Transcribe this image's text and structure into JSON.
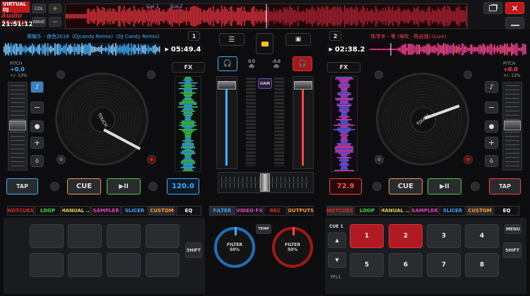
{
  "app": {
    "logo_line1": "VIRTUAL DJ",
    "logo_line2": "Audio TOUCH",
    "clock": "21:51:12",
    "col_label": "COL",
    "wave_label": "WAVE",
    "plus": "+",
    "minus": "−"
  },
  "overview": {
    "cue1": "Cue 1",
    "cue2": "Cue 2"
  },
  "window": {
    "restore_icon": "restore-icon",
    "close_icon": "close-icon",
    "minimize_icon": "minimize-icon"
  },
  "deck1": {
    "number": "1",
    "title": "荣耀乐 - 夜色2018（DJcandy Remix）(DJ Candy Remix)",
    "time": "05:49.4",
    "pitch_label": "PITCH",
    "pitch_value": "+0.0",
    "pitch_range": "+/- 13%",
    "fx": "FX",
    "tap": "TAP",
    "cue": "CUE",
    "play": "▶II",
    "bpm": "120.0",
    "platter_label": "TOUCH",
    "pitch_slider": 0.5
  },
  "deck2": {
    "number": "2",
    "title": "陈学冬 - 等 (电吹 · 陈自强) (Live)",
    "time": "02:38.2",
    "pitch_label": "PITCH",
    "pitch_value": "+0.0",
    "pitch_range": "+/- 13%",
    "fx": "FX",
    "tap": "TAP",
    "cue": "CUE",
    "play": "▶II",
    "bpm": "72.9",
    "platter_label": "TOUCH",
    "pitch_slider": 0.5
  },
  "mixer": {
    "left_db": "0.0",
    "left_db_unit": "db",
    "right_db": "-0.0",
    "right_db_unit": "db",
    "gain": "GAIN",
    "left_volume": 0.95,
    "right_volume": 0.95,
    "crossfader": 0.5
  },
  "tabs_left": [
    {
      "label": "HOTCUES",
      "color": "#e02a2a"
    },
    {
      "label": "LOOP",
      "color": "#3fd13f"
    },
    {
      "label": "MANUAL ...",
      "color": "#e0d040"
    },
    {
      "label": "SAMPLER",
      "color": "#e040c0"
    },
    {
      "label": "SLICER",
      "color": "#40a0ff"
    },
    {
      "label": "CUSTOM",
      "color": "#ff9a30"
    },
    {
      "label": "EQ",
      "color": "#ffffff"
    }
  ],
  "tabs_center": [
    {
      "label": "FILTER",
      "color": "#40a0ff"
    },
    {
      "label": "VIDEO FX",
      "color": "#e040c0"
    },
    {
      "label": "REC",
      "color": "#e02a2a"
    },
    {
      "label": "OUTPUTS",
      "color": "#ff9a30"
    }
  ],
  "tabs_right": [
    {
      "label": "HOTCUES",
      "color": "#e02a2a"
    },
    {
      "label": "LOOP",
      "color": "#3fd13f"
    },
    {
      "label": "MANUAL ...",
      "color": "#e0d040"
    },
    {
      "label": "SAMPLER",
      "color": "#e040c0"
    },
    {
      "label": "SLICER",
      "color": "#40a0ff"
    },
    {
      "label": "CUSTOM",
      "color": "#ff9a30"
    },
    {
      "label": "EQ",
      "color": "#ffffff"
    }
  ],
  "bottom": {
    "shift": "SHIFT",
    "temp": "TEMP",
    "filter_left": "FILTER",
    "filter_left_value": "50%",
    "filter_right": "FILTER",
    "filter_right_value": "50%",
    "cue_label": "CUE 1",
    "pfl": "PFL1",
    "menu": "MENU",
    "shift_right": "SHIFT",
    "right_pads": [
      "1",
      "2",
      "3",
      "4",
      "5",
      "6",
      "7",
      "8"
    ]
  }
}
